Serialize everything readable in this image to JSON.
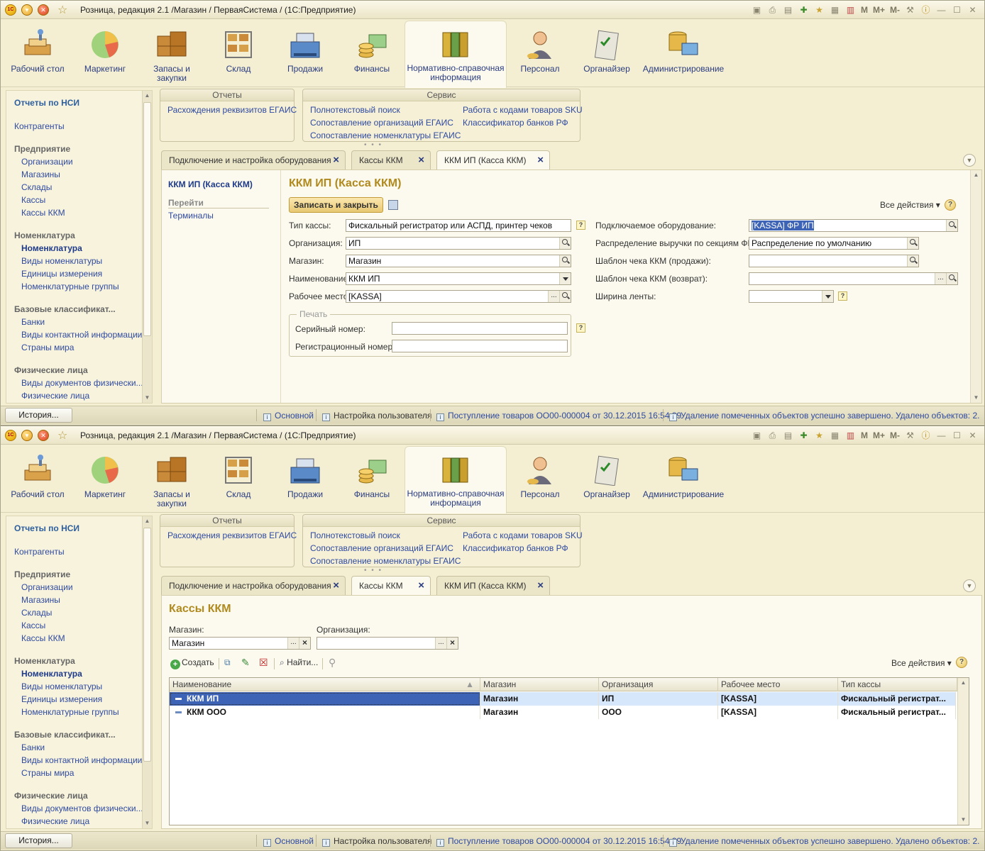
{
  "app_title": "Розница, редакция 2.1 /Магазин / ПерваяСистема / (1С:Предприятие)",
  "toolbar_icons": [
    "save-icon",
    "print-icon",
    "preview-icon",
    "add-favorite-icon",
    "favorites-icon",
    "calculator-icon",
    "calendar-icon"
  ],
  "toolbar_memory": [
    "M",
    "M+",
    "M-"
  ],
  "sections": [
    {
      "label": "Рабочий стол",
      "icon": "desktop-icon"
    },
    {
      "label": "Маркетинг",
      "icon": "pie-chart-icon"
    },
    {
      "label": "Запасы и закупки",
      "icon": "boxes-icon"
    },
    {
      "label": "Склад",
      "icon": "warehouse-rack-icon"
    },
    {
      "label": "Продажи",
      "icon": "cash-register-icon"
    },
    {
      "label": "Финансы",
      "icon": "coins-icon"
    },
    {
      "label": "Нормативно-справочная информация",
      "icon": "binders-icon"
    },
    {
      "label": "Персонал",
      "icon": "person-icon"
    },
    {
      "label": "Органайзер",
      "icon": "clipboard-icon"
    },
    {
      "label": "Администрирование",
      "icon": "database-computer-icon"
    }
  ],
  "sidebar": {
    "reports_header": "Отчеты по НСИ",
    "counterparties": "Контрагенты",
    "groups": [
      {
        "title": "Предприятие",
        "items": [
          "Организации",
          "Магазины",
          "Склады",
          "Кассы",
          "Кассы ККМ"
        ]
      },
      {
        "title": "Номенклатура",
        "items": [
          "Номенклатура",
          "Виды номенклатуры",
          "Единицы измерения",
          "Номенклатурные группы"
        ]
      },
      {
        "title": "Базовые классификат...",
        "items": [
          "Банки",
          "Виды контактной информации",
          "Страны мира"
        ]
      },
      {
        "title": "Физические лица",
        "items": [
          "Виды документов физически...",
          "Физические лица"
        ]
      }
    ]
  },
  "reports_panel": {
    "title": "Отчеты",
    "items": [
      "Расхождения реквизитов ЕГАИС"
    ]
  },
  "service_panel": {
    "title": "Сервис",
    "col1": [
      "Полнотекстовый поиск",
      "Сопоставление организаций ЕГАИС",
      "Сопоставление номенклатуры ЕГАИС"
    ],
    "col2": [
      "Работа с кодами товаров SKU",
      "Классификатор банков РФ"
    ]
  },
  "tabs": [
    "Подключение и настройка оборудования",
    "Кассы ККМ",
    "ККМ ИП (Касса ККМ)"
  ],
  "form": {
    "nav_title": "ККМ ИП (Касса ККМ)",
    "nav_go": "Перейти",
    "nav_terminals": "Терминалы",
    "title": "ККМ ИП (Касса ККМ)",
    "save_close": "Записать и закрыть",
    "all_actions": "Все действия",
    "fields_left": [
      {
        "label": "Тип кассы:",
        "value": "Фискальный регистратор или АСПД, принтер чеков"
      },
      {
        "label": "Организация:",
        "value": "ИП"
      },
      {
        "label": "Магазин:",
        "value": "Магазин"
      },
      {
        "label": "Наименование:",
        "value": "ККМ ИП"
      },
      {
        "label": "Рабочее место:",
        "value": "[KASSA]"
      }
    ],
    "fields_right": [
      {
        "label": "Подключаемое оборудование:",
        "value": "[KASSA] ФР ИП"
      },
      {
        "label": "Распределение выручки по секциям ФР:",
        "value": "Распределение по умолчанию"
      },
      {
        "label": "Шаблон чека ККМ (продажи):",
        "value": ""
      },
      {
        "label": "Шаблон чека ККМ (возврат):",
        "value": ""
      },
      {
        "label": "Ширина ленты:",
        "value": ""
      }
    ],
    "print_group": "Печать",
    "serial_label": "Серийный номер:",
    "serial_value": "",
    "reg_label": "Регистрационный номер:",
    "reg_value": ""
  },
  "list": {
    "title": "Кассы ККМ",
    "store_label": "Магазин:",
    "store_value": "Магазин",
    "org_label": "Организация:",
    "org_value": "",
    "create": "Создать",
    "find": "Найти...",
    "all_actions": "Все действия",
    "columns": [
      "Наименование",
      "Магазин",
      "Организация",
      "Рабочее место",
      "Тип кассы"
    ],
    "rows": [
      [
        "ККМ ИП",
        "Магазин",
        "ИП",
        "[KASSA]",
        "Фискальный регистрат..."
      ],
      [
        "ККМ ООО",
        "Магазин",
        "ООО",
        "[KASSA]",
        "Фискальный регистрат..."
      ]
    ]
  },
  "status": {
    "history": "История...",
    "items": [
      "Основной",
      "Настройка пользователя",
      "Поступление товаров ОО00-000004 от 30.12.2015 16:54:39",
      "Удаление помеченных объектов успешно завершено. Удалено объектов: 2."
    ]
  },
  "colors": {
    "accent_title": "#b08a1e",
    "link": "#2f4aa0",
    "bg": "#f4efd2",
    "selected": "#3d63b6"
  }
}
